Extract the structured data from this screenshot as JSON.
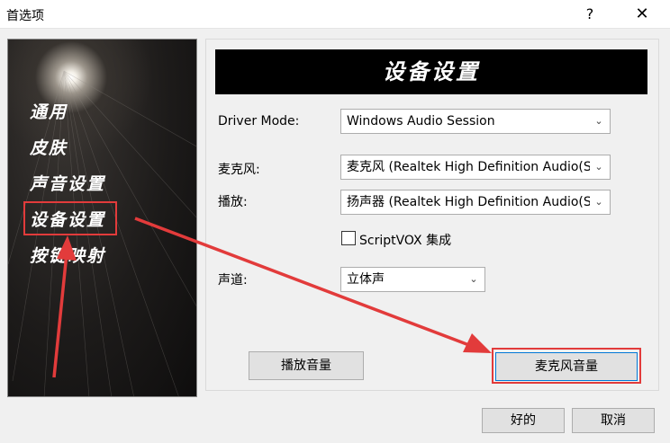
{
  "window": {
    "title": "首选项",
    "help_glyph": "?",
    "close_glyph": "✕"
  },
  "sidebar": {
    "items": [
      {
        "label": "通用"
      },
      {
        "label": "皮肤"
      },
      {
        "label": "声音设置"
      },
      {
        "label": "设备设置",
        "active": true
      },
      {
        "label": "按键映射"
      }
    ]
  },
  "main": {
    "banner_title": "设备设置",
    "driver_mode": {
      "label": "Driver Mode:",
      "value": "Windows Audio Session"
    },
    "microphone": {
      "label": "麦克风:",
      "value": "麦克风 (Realtek High Definition Audio(S"
    },
    "playback": {
      "label": "播放:",
      "value": "扬声器 (Realtek High Definition Audio(S"
    },
    "scriptvox": {
      "label": "ScriptVOX 集成",
      "checked": false
    },
    "channel": {
      "label": "声道:",
      "value": "立体声"
    },
    "playback_volume_button": "播放音量",
    "mic_volume_button": "麦克风音量"
  },
  "footer": {
    "ok_button": "好的",
    "cancel_button": "取消"
  },
  "colors": {
    "annotation_red": "#e23b3b",
    "focus_blue": "#0078d7"
  }
}
